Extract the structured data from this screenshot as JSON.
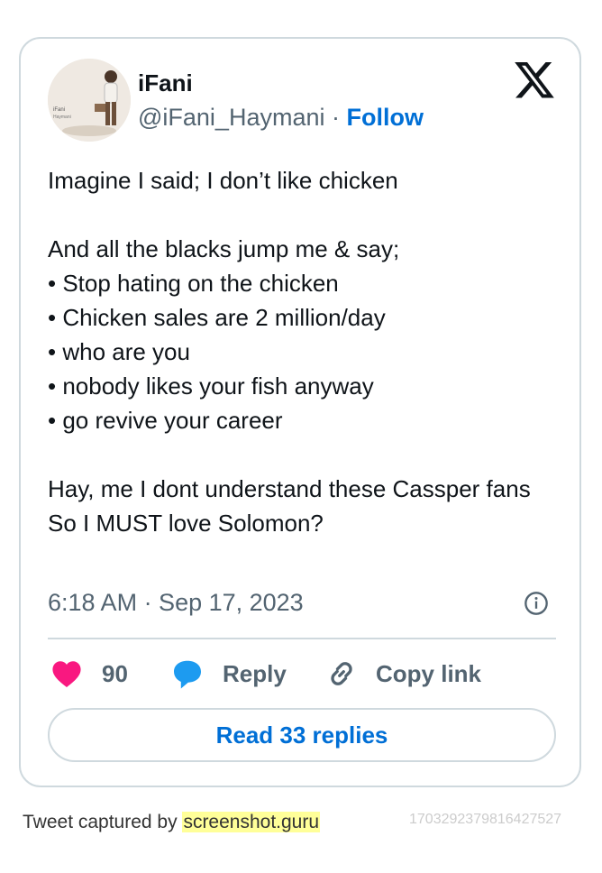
{
  "tweet": {
    "author_name": "iFani",
    "handle": "@iFani_Haymani",
    "separator": " · ",
    "follow_label": "Follow",
    "text": "Imagine I said; I don’t like chicken\n\nAnd all the blacks jump me & say;\n• Stop hating on the chicken\n• Chicken sales are 2 million/day\n• who are you\n• nobody likes your fish anyway\n• go revive your career\n\nHay, me I dont understand these Cassper fans\nSo I MUST love Solomon?",
    "timestamp": "6:18 AM · Sep 17, 2023"
  },
  "actions": {
    "like_count": "90",
    "reply_label": "Reply",
    "copy_label": "Copy link"
  },
  "read_replies_label": "Read 33 replies",
  "footer": {
    "captured_by": "Tweet captured by ",
    "site": "screenshot.guru",
    "tweet_id": "1703292379816427527"
  },
  "colors": {
    "accent": "#006fd6",
    "like": "#f91880",
    "reply": "#1d9bf0",
    "muted": "#536471",
    "border": "#cfd9de"
  },
  "icons": {
    "brand": "x-logo-icon",
    "like": "heart-icon",
    "reply": "speech-bubble-icon",
    "copy": "link-icon",
    "info": "info-icon"
  }
}
